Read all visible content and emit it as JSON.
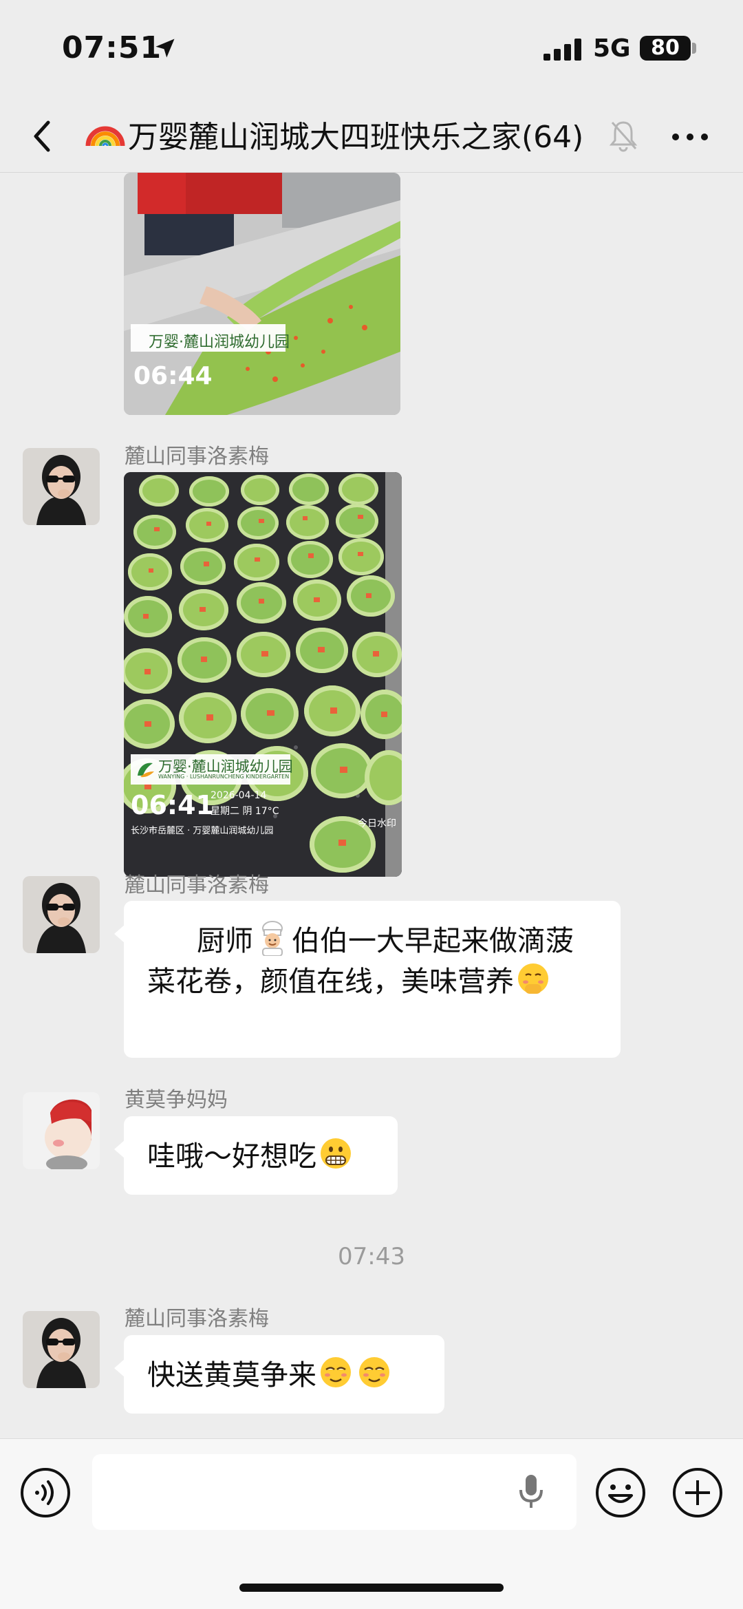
{
  "status": {
    "time": "07:51",
    "network": "5G",
    "battery": "80"
  },
  "header": {
    "title": "万婴麓山润城大四班快乐之家",
    "count": "(64)"
  },
  "messages": [
    {
      "sender": "麓山同事洛素梅",
      "photo_brand": "万婴·麓山润城幼儿园",
      "photo_brand_en": "WANYING · LUSHANRUNCHENG KINDERGARTEN",
      "photo_time": "06:41",
      "photo_date": "2026-04-14",
      "photo_weekday": "星期二 阴 17°C",
      "photo_location": "长沙市岳麓区 · 万婴麓山润城幼儿园",
      "photo_watermark": "今日水印"
    },
    {
      "sender": "麓山同事洛素梅",
      "text_a": "厨师",
      "text_b": "伯伯一大早起来做滴菠菜花卷，颜值在线，美味营养"
    },
    {
      "sender": "黄莫争妈妈",
      "text": "哇哦～好想吃"
    },
    {
      "timestamp": "07:43"
    },
    {
      "sender": "麓山同事洛素梅",
      "text": "快送黄莫争来"
    }
  ],
  "top_photo": {
    "brand": "万婴·麓山润城幼儿园",
    "time": "06:44"
  },
  "input": {
    "placeholder": ""
  },
  "colors": {
    "background": "#ededed",
    "bubble": "#ffffff",
    "sender": "#7f7f7f",
    "spinach": "#8fc25a"
  }
}
